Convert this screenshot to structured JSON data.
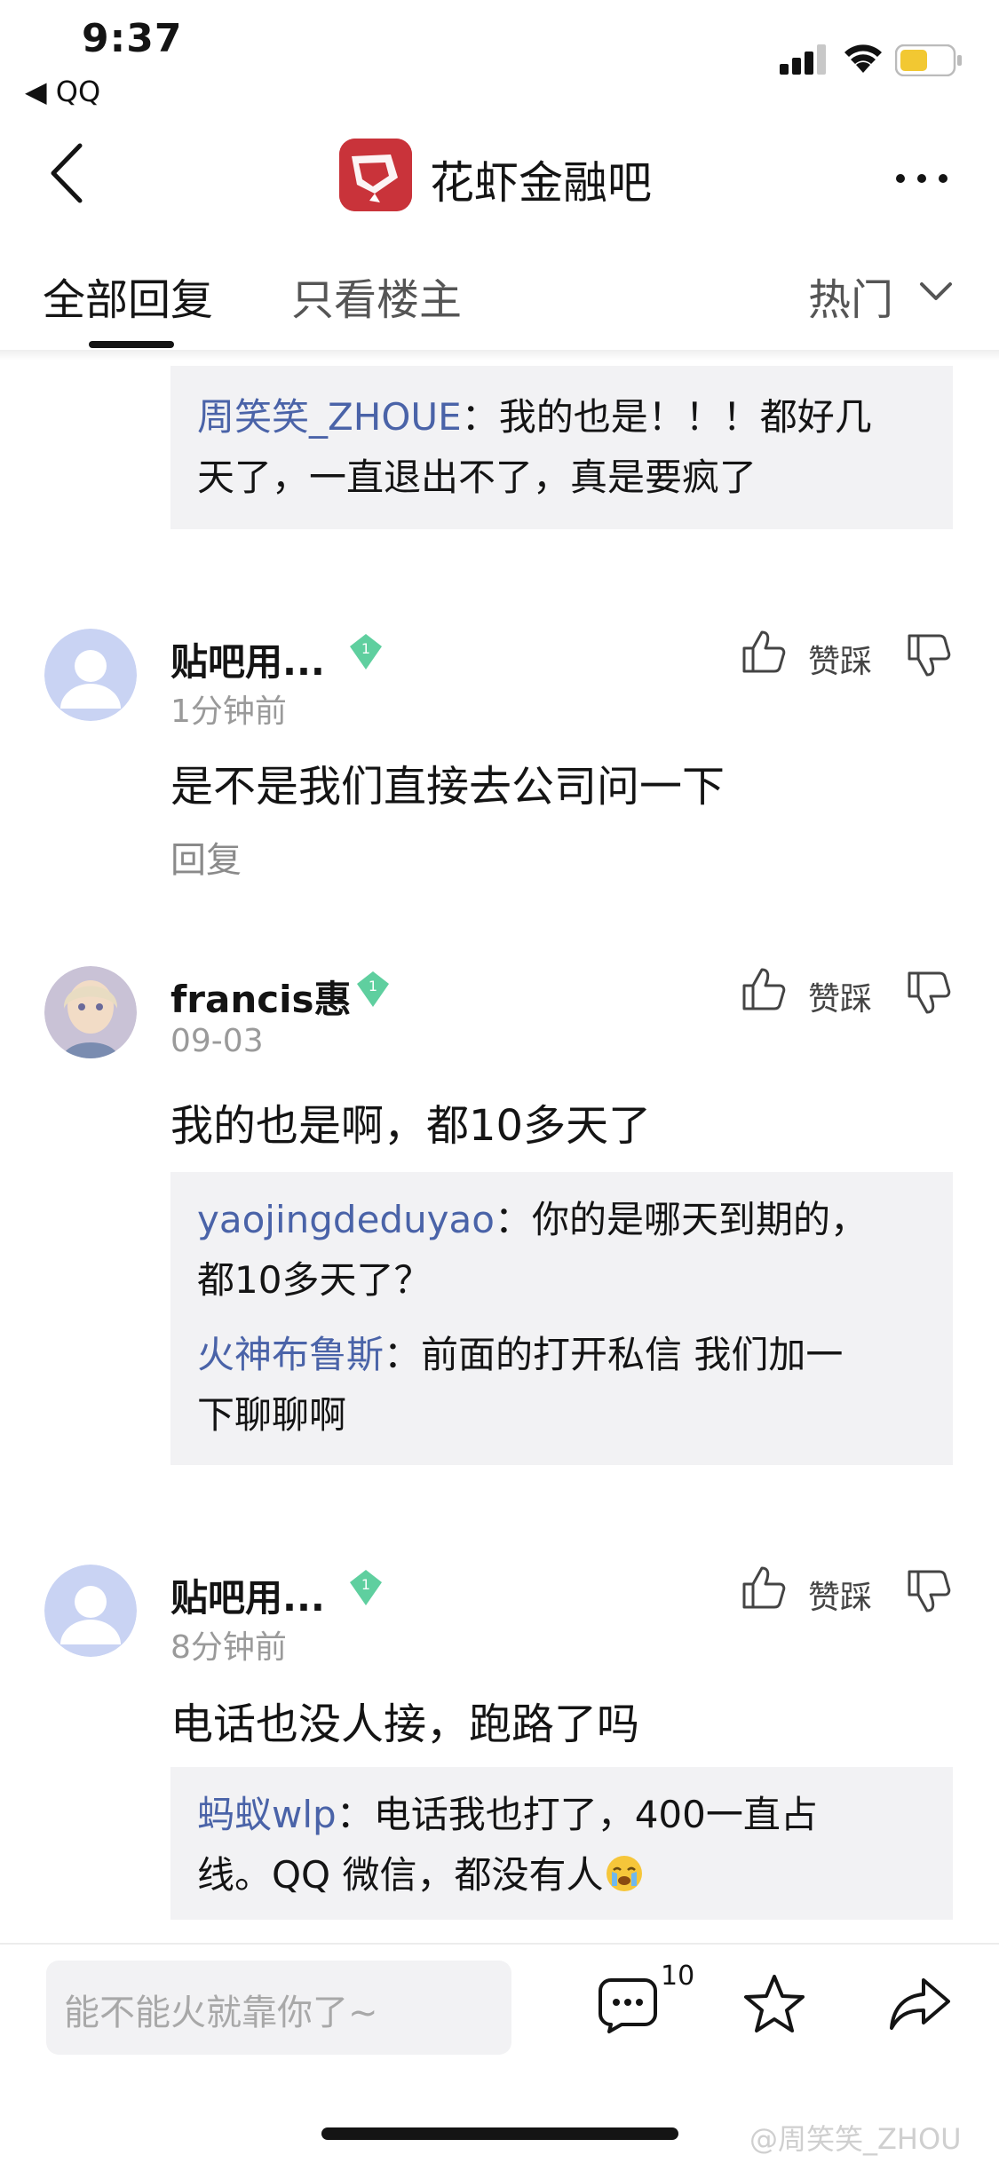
{
  "status_bar": {
    "time": "9:37",
    "back_app": "◀ QQ"
  },
  "header": {
    "title": "花虾金融吧"
  },
  "tabs": {
    "all": "全部回复",
    "owner_only": "只看楼主",
    "sort": "热门"
  },
  "quote_top": {
    "name": "周笑笑_ZHOUE",
    "sep": "：",
    "line1": "我的也是！！！都好几",
    "line2": "天了，一直退出不了，真是要疯了"
  },
  "comments": [
    {
      "user": "贴吧用...",
      "badge_level": "1",
      "time": "1分钟前",
      "text": "是不是我们直接去公司问一下",
      "reply_label": "回复",
      "vote_label": "赞踩"
    },
    {
      "user": "francis惠",
      "badge_level": "1",
      "time": "09-03",
      "text": "我的也是啊，都10多天了",
      "vote_label": "赞踩",
      "replies": [
        {
          "name": "yaojingdeduyao",
          "sep": "：",
          "line1": "你的是哪天到期的，",
          "line2": "都10多天了？"
        },
        {
          "name": "火神布鲁斯",
          "sep": "：",
          "line1": "前面的打开私信 我们加一",
          "line2": "下聊聊啊"
        }
      ]
    },
    {
      "user": "贴吧用...",
      "badge_level": "1",
      "time": "8分钟前",
      "text": "电话也没人接，跑路了吗",
      "vote_label": "赞踩",
      "replies": [
        {
          "name": "蚂蚁wlp",
          "sep": "：",
          "line1": "电话我也打了，400一直占",
          "line2": "线。QQ 微信，都没有人"
        }
      ]
    }
  ],
  "bottom_bar": {
    "input_placeholder": "能不能火就靠你了~",
    "comment_count": "10"
  },
  "watermark": "@周笑笑_ZHOU",
  "colors": {
    "logo_red": "#c9333a",
    "username_link": "#4a63a8",
    "badge_green": "#5fcf9f"
  }
}
